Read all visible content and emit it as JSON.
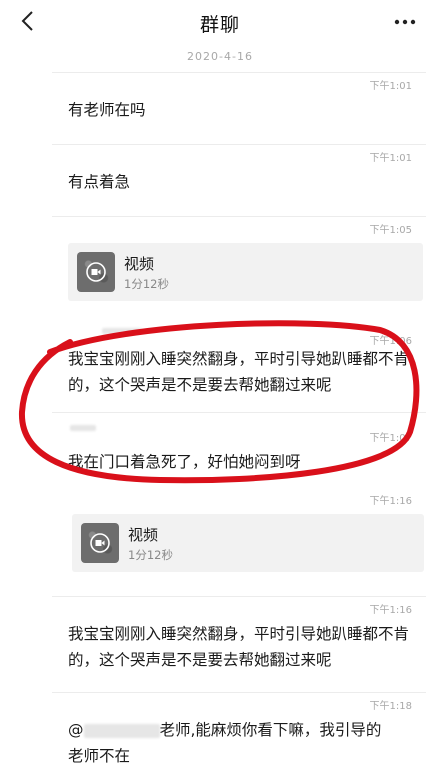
{
  "header": {
    "title": "群聊"
  },
  "date_divider": "2020-4-16",
  "messages": [
    {
      "time": "下午1:01",
      "text": "有老师在吗"
    },
    {
      "time": "下午1:01",
      "text": "有点着急"
    },
    {
      "time": "下午1:05",
      "video_title": "视频",
      "video_duration": "1分12秒"
    },
    {
      "time": "下午1:06",
      "text": "我宝宝刚刚入睡突然翻身，平时引导她趴睡都不肯的，这个哭声是不是要去帮她翻过来呢"
    },
    {
      "time": "下午1:07",
      "text": "我在门口着急死了，好怕她闷到呀"
    },
    {
      "time": "下午1:16",
      "video_title": "视频",
      "video_duration": "1分12秒"
    },
    {
      "time": "下午1:16",
      "text": "我宝宝刚刚入睡突然翻身，平时引导她趴睡都不肯的，这个哭声是不是要去帮她翻过来呢"
    },
    {
      "time": "下午1:18",
      "mention_prefix": "@",
      "text_part1": "老师,能麻烦你看下嘛，我引导的",
      "text_part2": "老师不在"
    }
  ],
  "colors": {
    "annotation_ring": "#d9101a",
    "divider": "#ececec",
    "timestamp": "#a8a8a8"
  },
  "icons": {
    "back": "chevron-left-icon",
    "more": "more-dots-icon",
    "video": "video-camera-icon"
  }
}
